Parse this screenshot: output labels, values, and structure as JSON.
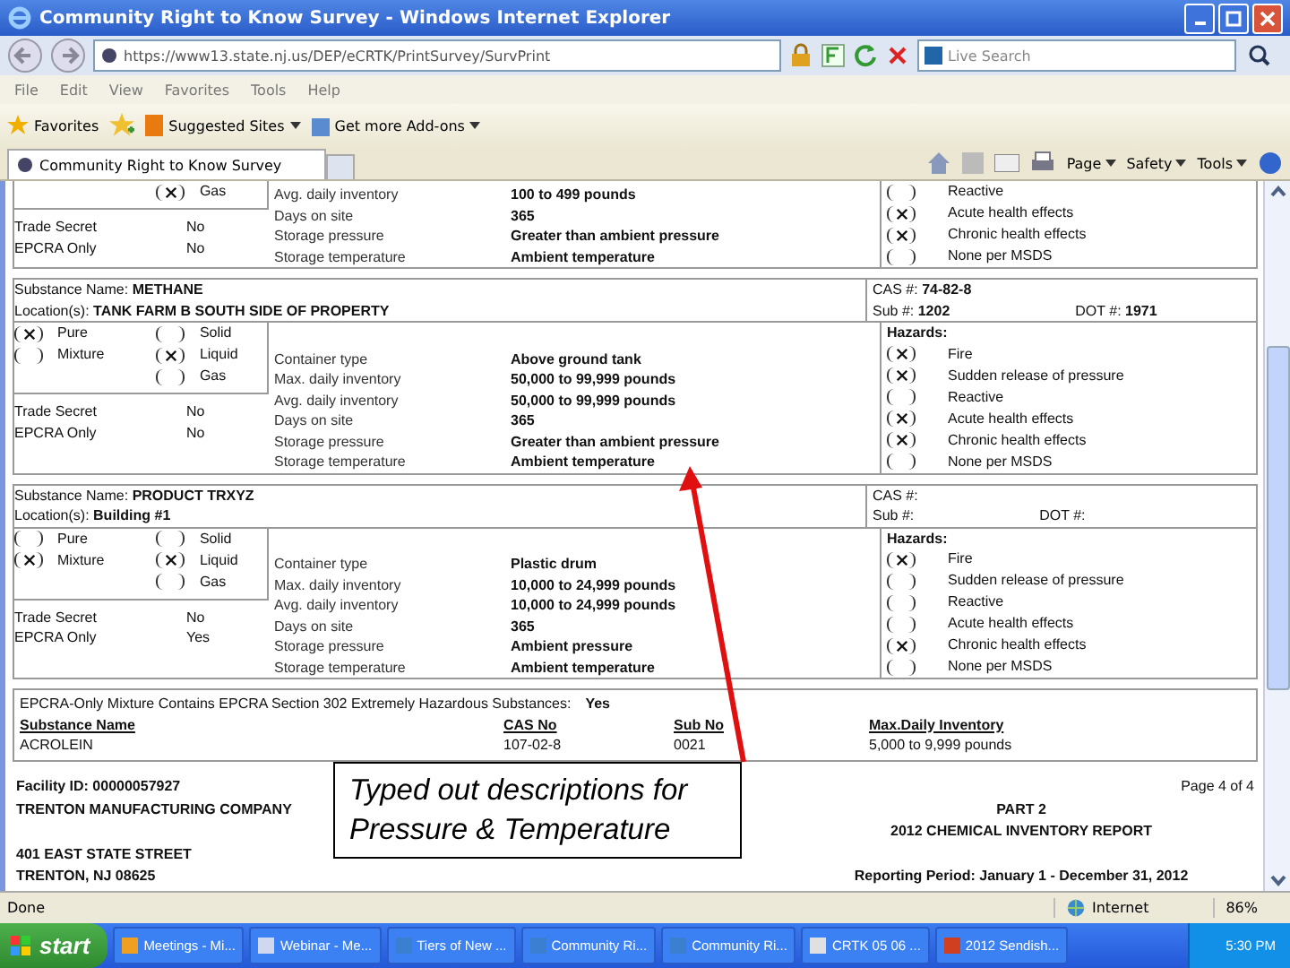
{
  "window": {
    "title": "Community Right to Know Survey - Windows Internet Explorer"
  },
  "address_bar": {
    "url": "https://www13.state.nj.us/DEP/eCRTK/PrintSurvey/SurvPrint",
    "search_placeholder": "Live Search"
  },
  "menu": [
    "File",
    "Edit",
    "View",
    "Favorites",
    "Tools",
    "Help"
  ],
  "favorites_bar": [
    {
      "kind": "favorites",
      "label": "Favorites"
    },
    {
      "kind": "site",
      "label": "Suggested Sites"
    },
    {
      "kind": "addon",
      "label": "Get more Add-ons"
    }
  ],
  "tabs": [
    {
      "label": "Community Right to Know Survey",
      "selected": true
    }
  ],
  "commands": [
    "Page",
    "Safety",
    "Tools"
  ],
  "substances": [
    {
      "state": [
        {
          "label": "Gas",
          "selected": true
        }
      ],
      "properties": [
        {
          "label": "Avg. daily inventory",
          "value": "100 to 499 pounds"
        },
        {
          "label": "Days on site",
          "value": "365"
        },
        {
          "label": "Storage pressure",
          "value": "Greater than ambient pressure"
        },
        {
          "label": "Storage temperature",
          "value": "Ambient temperature"
        }
      ],
      "flags": [
        {
          "label": "Trade Secret",
          "value": "No"
        },
        {
          "label": "EPCRA Only",
          "value": "No"
        }
      ],
      "hazards": [
        {
          "label": "Reactive",
          "checked": false
        },
        {
          "label": "Acute health effects",
          "checked": true
        },
        {
          "label": "Chronic health effects",
          "checked": true
        },
        {
          "label": "None per MSDS",
          "checked": false
        }
      ]
    },
    {
      "name": "Substance Name: **METHANE**",
      "location": "Location(s): **TANK FARM B SOUTH SIDE OF PROPERTY**",
      "cas": "CAS #: **74-82-8**",
      "sub": "Sub #: **1202**",
      "dot": "DOT #: **1971**",
      "purity": [
        {
          "label": "Pure",
          "selected": true
        },
        {
          "label": "Mixture",
          "selected": false
        }
      ],
      "state": [
        {
          "label": "Solid",
          "selected": false
        },
        {
          "label": "Liquid",
          "selected": true
        },
        {
          "label": "Gas",
          "selected": false
        }
      ],
      "properties": [
        {
          "label": "Container type",
          "value": "Above ground tank"
        },
        {
          "label": "Max. daily inventory",
          "value": "50,000 to 99,999 pounds"
        },
        {
          "label": "Avg. daily inventory",
          "value": "50,000 to 99,999 pounds"
        },
        {
          "label": "Days on site",
          "value": "365"
        },
        {
          "label": "Storage pressure",
          "value": "Greater than ambient pressure"
        },
        {
          "label": "Storage temperature",
          "value": "Ambient temperature"
        }
      ],
      "flags": [
        {
          "label": "Trade Secret",
          "value": "No"
        },
        {
          "label": "EPCRA Only",
          "value": "No"
        }
      ],
      "hazards_title": "Hazards:",
      "hazards": [
        {
          "label": "Fire",
          "checked": true
        },
        {
          "label": "Sudden release of pressure",
          "checked": true
        },
        {
          "label": "Reactive",
          "checked": false
        },
        {
          "label": "Acute health effects",
          "checked": true
        },
        {
          "label": "Chronic health effects",
          "checked": true
        },
        {
          "label": "None per MSDS",
          "checked": false
        }
      ]
    },
    {
      "name": "Substance Name: **PRODUCT TRXYZ**",
      "location": "Location(s): **Building #1**",
      "cas": "CAS #:",
      "sub": "Sub #:",
      "dot": "DOT #:",
      "purity": [
        {
          "label": "Pure",
          "selected": false
        },
        {
          "label": "Mixture",
          "selected": true
        }
      ],
      "state": [
        {
          "label": "Solid",
          "selected": false
        },
        {
          "label": "Liquid",
          "selected": true
        },
        {
          "label": "Gas",
          "selected": false
        }
      ],
      "properties": [
        {
          "label": "Container type",
          "value": "Plastic drum"
        },
        {
          "label": "Max. daily inventory",
          "value": "10,000 to 24,999 pounds"
        },
        {
          "label": "Avg. daily inventory",
          "value": "10,000 to 24,999 pounds"
        },
        {
          "label": "Days on site",
          "value": "365"
        },
        {
          "label": "Storage pressure",
          "value": "Ambient pressure"
        },
        {
          "label": "Storage temperature",
          "value": "Ambient temperature"
        }
      ],
      "flags": [
        {
          "label": "Trade Secret",
          "value": "No"
        },
        {
          "label": "EPCRA Only",
          "value": "Yes"
        }
      ],
      "hazards_title": "Hazards:",
      "hazards": [
        {
          "label": "Fire",
          "checked": true
        },
        {
          "label": "Sudden release of pressure",
          "checked": false
        },
        {
          "label": "Reactive",
          "checked": false
        },
        {
          "label": "Acute health effects",
          "checked": false
        },
        {
          "label": "Chronic health effects",
          "checked": true
        },
        {
          "label": "None per MSDS",
          "checked": false
        }
      ]
    }
  ],
  "mixture": {
    "question": "EPCRA-Only Mixture Contains EPCRA Section 302 Extremely Hazardous Substances:",
    "answer": "Yes",
    "columns": [
      "Substance Name",
      "CAS No",
      "Sub No",
      "Max.Daily Inventory"
    ],
    "rows": [
      [
        "ACROLEIN",
        "107-02-8",
        "0021",
        "5,000 to 9,999 pounds"
      ]
    ]
  },
  "footer": {
    "facility_id": "Facility ID: 00000057927",
    "page": "Page 4 of 4",
    "company": "TRENTON MANUFACTURING COMPANY",
    "part": "PART 2",
    "report_title": "2012 CHEMICAL INVENTORY REPORT",
    "street": "401 EAST STATE STREET",
    "city": "TRENTON, NJ 08625",
    "period": "Reporting Period: January 1 - December 31, 2012"
  },
  "callout": {
    "text": "Typed out descriptions for Pressure & Temperature"
  },
  "status_bar": {
    "text": "Done",
    "zone": "Internet",
    "zoom": "86%"
  },
  "taskbar": {
    "start": "start",
    "items": [
      {
        "label": "Meetings - Mi...",
        "color": "#f0a020"
      },
      {
        "label": "Webinar - Me...",
        "color": "#d0d8f0"
      },
      {
        "label": "Tiers of New ...",
        "color": "#3a7fd0"
      },
      {
        "label": "Community Ri...",
        "color": "#3a7fd0"
      },
      {
        "label": "Community Ri...",
        "color": "#3a7fd0"
      },
      {
        "label": "CRTK 05 06 ...",
        "color": "#e0e0e0"
      },
      {
        "label": "2012 Sendish...",
        "color": "#d04020"
      }
    ],
    "clock": "5:30 PM"
  }
}
